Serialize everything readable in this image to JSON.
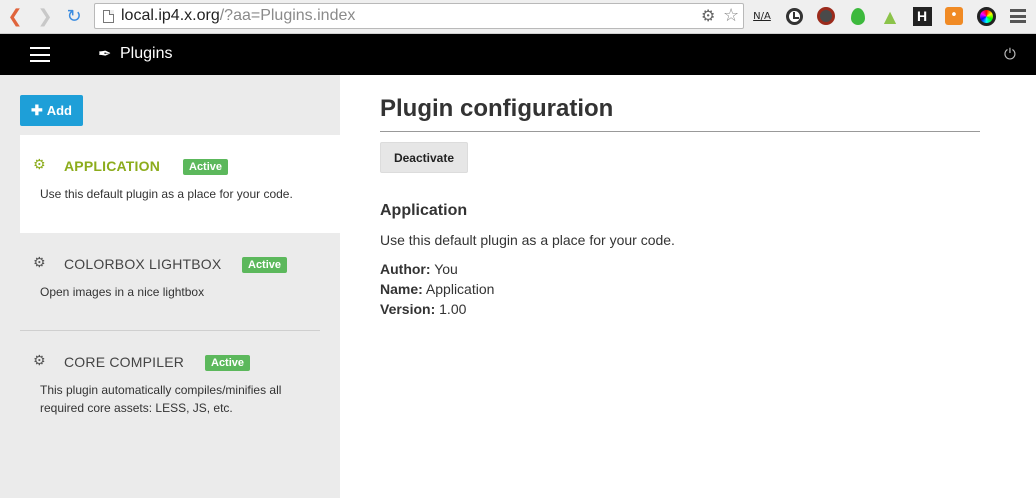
{
  "browser": {
    "url_host": "local.ip4.x.org",
    "url_rest": "/?aa=Plugins.index",
    "extensions": {
      "na_top": "N/A",
      "h_label": "H",
      "rss_symbol": "◔"
    }
  },
  "navbar": {
    "title": "Plugins"
  },
  "sidebar": {
    "add_label": "Add",
    "plugins": [
      {
        "name": "APPLICATION",
        "badge": "Active",
        "description": "Use this default plugin as a place for your code.",
        "selected": true
      },
      {
        "name": "COLORBOX LIGHTBOX",
        "badge": "Active",
        "description": "Open images in a nice lightbox",
        "selected": false
      },
      {
        "name": "CORE COMPILER",
        "badge": "Active",
        "description_line1": "This plugin automatically compiles/minifies all",
        "description_line2": "required core assets: LESS, JS, etc.",
        "selected": false
      }
    ]
  },
  "main": {
    "title": "Plugin configuration",
    "deactivate_label": "Deactivate",
    "plugin_name": "Application",
    "plugin_description": "Use this default plugin as a place for your code.",
    "author_label": "Author:",
    "author_value": "You",
    "name_label": "Name:",
    "name_value": "Application",
    "version_label": "Version:",
    "version_value": "1.00"
  },
  "colors": {
    "accent_green": "#8cac1c",
    "badge_green": "#5cb85c",
    "add_blue": "#1e9fd8",
    "navbar_bg": "#000000",
    "sidebar_bg": "#ebebeb"
  }
}
